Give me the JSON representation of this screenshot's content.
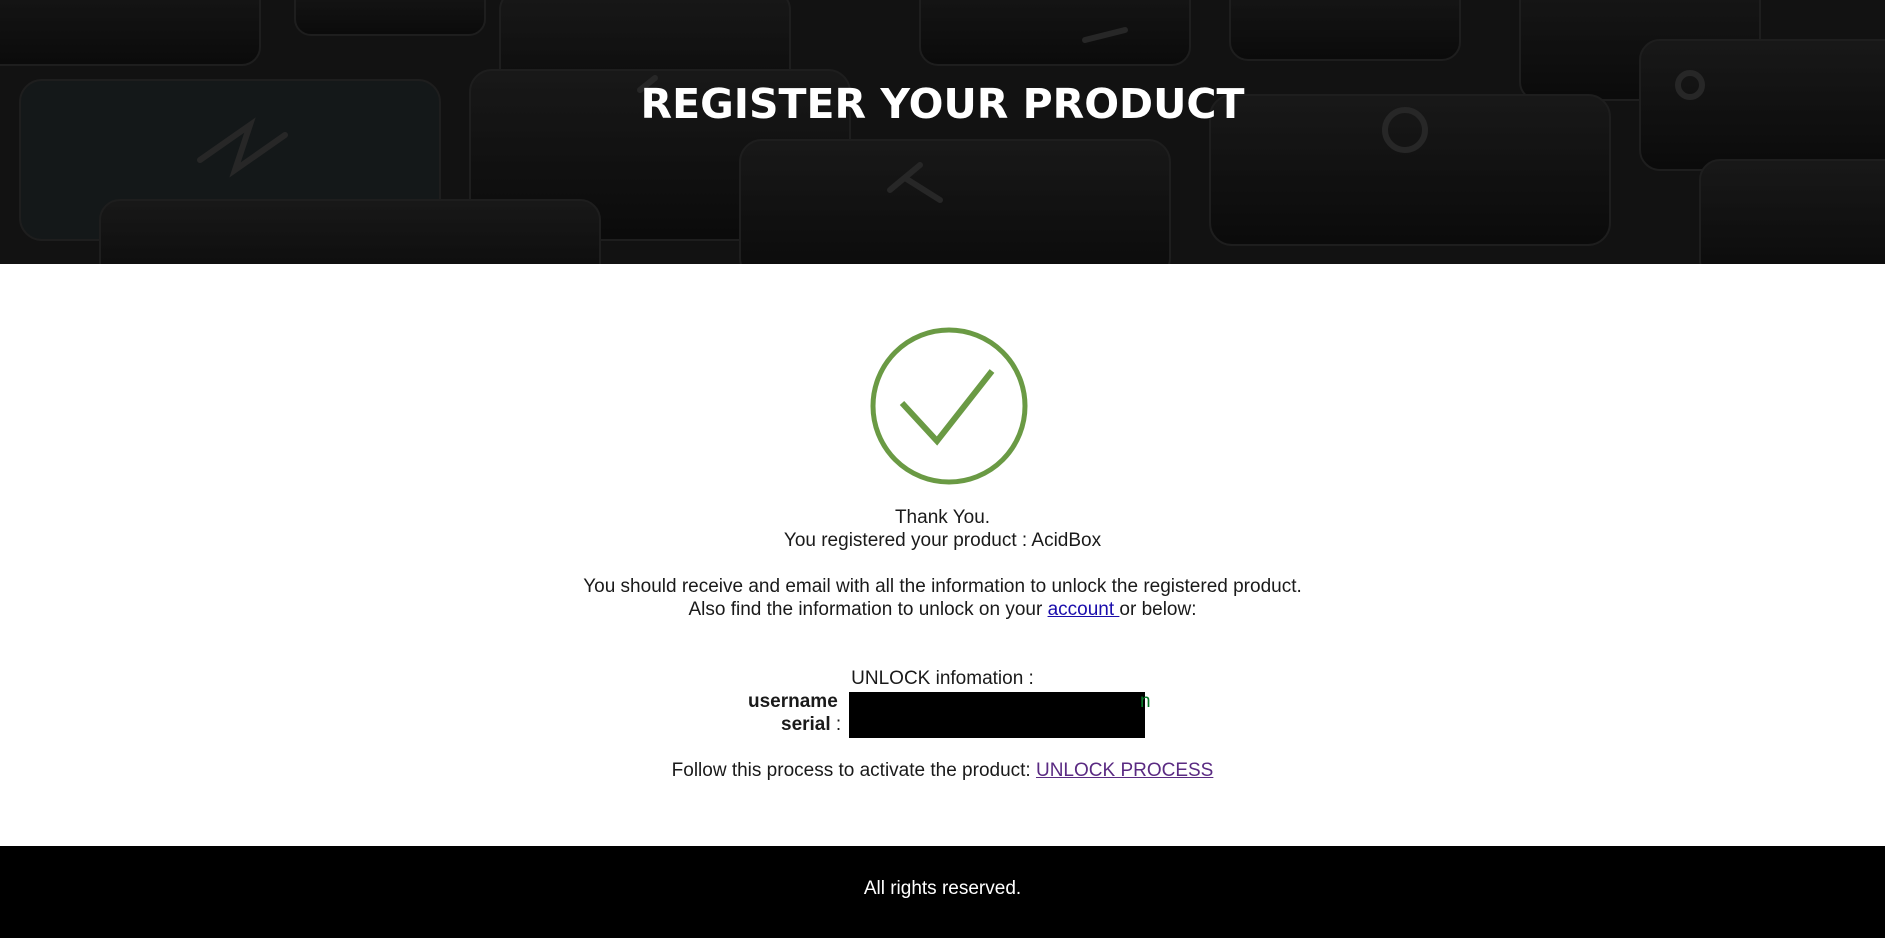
{
  "hero": {
    "title": "REGISTER YOUR PRODUCT"
  },
  "confirmation": {
    "icon": "checkmark-circle-icon",
    "icon_color": "#6a9a44",
    "thank_you": "Thank You.",
    "registered_prefix": "You registered your product : ",
    "product_name": "AcidBox",
    "email_notice": "You should receive and email with all the information to unlock the registered product.",
    "account_prefix": "Also find the information to unlock on your ",
    "account_link": "account ",
    "account_suffix": "or below:"
  },
  "unlock": {
    "heading": "UNLOCK infomation :",
    "username_label": "username",
    "serial_label": "serial",
    "serial_separator": " :",
    "process_prefix": "Follow this process to activate the product: ",
    "process_link": "UNLOCK PROCESS"
  },
  "footer": {
    "text": "All rights reserved."
  }
}
